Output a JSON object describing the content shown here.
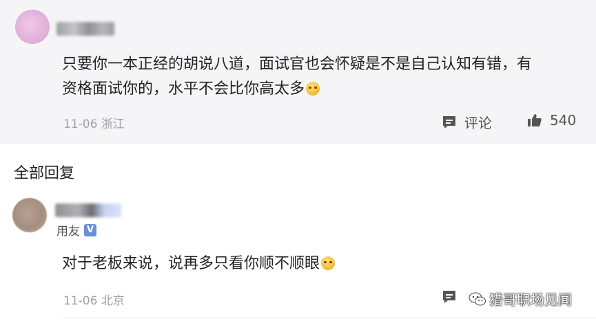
{
  "top_comment": {
    "line1": "只要你一本正经的胡说八道，面试官也会怀疑是不是自己认知有错，有",
    "line2": "资格面试你的，水平不会比你高太多",
    "date": "11-06",
    "location": "浙江",
    "comment_label": "评论",
    "like_count": "540"
  },
  "section_title": "全部回复",
  "reply": {
    "user_tag": "用友",
    "badge": "V",
    "text": "对于老板来说，说再多只看你顺不顺眼",
    "date": "11-06",
    "location": "北京"
  },
  "watermark": "猎哥职场见闻"
}
